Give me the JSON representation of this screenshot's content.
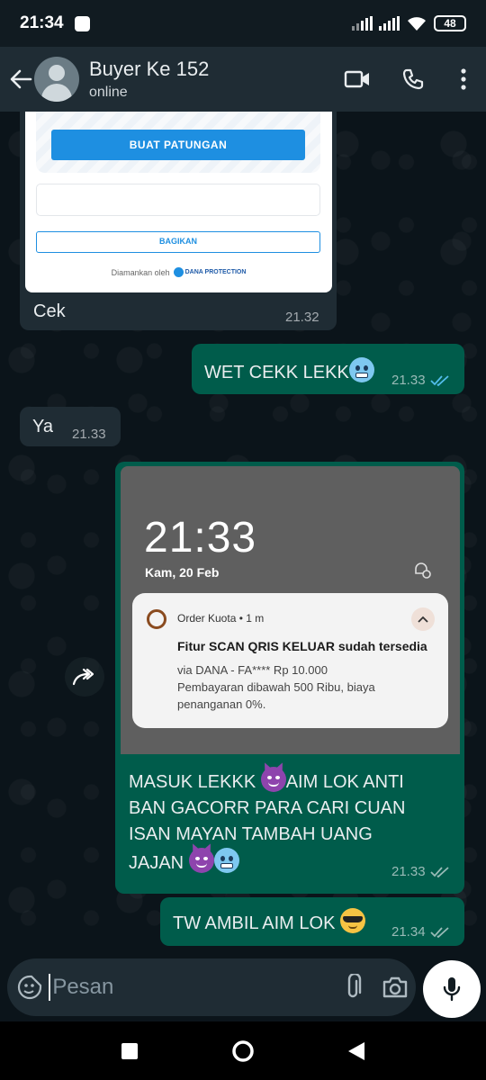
{
  "status_bar": {
    "time": "21:34",
    "battery": "48"
  },
  "header": {
    "contact_name": "Buyer Ke 152",
    "contact_status": "online"
  },
  "messages": [
    {
      "direction": "in",
      "image": {
        "primary_button": "BUAT PATUNGAN",
        "share_button": "BAGIKAN",
        "secured_by": "Diamankan oleh",
        "secured_brand": "DANA PROTECTION"
      },
      "text": "Cek",
      "time": "21.32"
    },
    {
      "direction": "out",
      "text": "WET CEKK LEKK",
      "emoji": [
        "cold-face"
      ],
      "time": "21.33",
      "status": "read"
    },
    {
      "direction": "in",
      "text": "Ya",
      "time": "21.33"
    },
    {
      "direction": "out",
      "image": {
        "lock_time": "21:33",
        "lock_date": "Kam, 20 Feb",
        "notification": {
          "app": "Order Kuota • 1 m",
          "title": "Fitur SCAN QRIS KELUAR sudah tersedia",
          "line1": "via DANA - FA**** Rp 10.000",
          "line2": "Pembayaran dibawah 500 Ribu, biaya",
          "line3": "penanganan 0%."
        }
      },
      "text_parts": [
        "MASUK LEKKK ",
        "AIM LOK ANTI",
        "BAN GACORR PARA CARI CUAN",
        "ISAN MAYAN TAMBAH UANG",
        "JAJAN "
      ],
      "emoji": [
        "smiling-devil",
        "smiling-devil",
        "cold-face"
      ],
      "time": "21.33",
      "status": "delivered"
    },
    {
      "direction": "out",
      "text": "TW AMBIL AIM LOK ",
      "emoji": [
        "sunglasses-face"
      ],
      "time": "21.34",
      "status": "delivered"
    }
  ],
  "input": {
    "placeholder": "Pesan",
    "value": ""
  },
  "colors": {
    "chat_background": "#0b141a",
    "incoming_bubble": "#1f2c34",
    "outgoing_bubble": "#005c4b",
    "read_tick": "#53bdeb",
    "header": "#1f2c34"
  },
  "icons": [
    "back-arrow-icon",
    "video-call-icon",
    "voice-call-icon",
    "more-options-icon",
    "forward-icon",
    "emoji-sticker-icon",
    "attach-icon",
    "camera-icon",
    "mic-icon"
  ]
}
